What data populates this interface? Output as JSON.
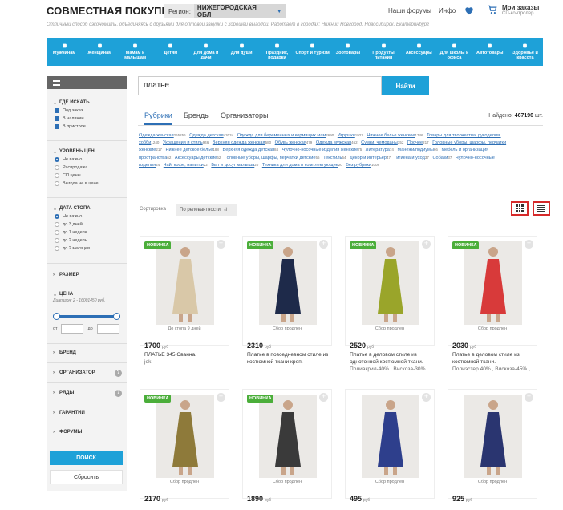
{
  "header": {
    "logo": "СОВМЕСТНАЯ ПОКУПКА",
    "slogan": "Отличный способ сэкономить, объединяясь с друзьями для оптовой закупки с хорошей выгодой. Работает в городах: Нижний Новгород, Новосибирск, Екатеринбург",
    "region_label": "Регион:",
    "region_value": "НИЖЕГОРОДСКАЯ ОБЛ",
    "links": [
      "Наши форумы",
      "Инфо"
    ],
    "orders_title": "Мои заказы",
    "orders_sub": "СП-контролер"
  },
  "categories": [
    {
      "label": "Мужчинам",
      "icon": "shirt-icon"
    },
    {
      "label": "Женщинам",
      "icon": "dress-icon"
    },
    {
      "label": "Мамам и малышам",
      "icon": "stroller-icon"
    },
    {
      "label": "Детям",
      "icon": "child-icon"
    },
    {
      "label": "Для дома и дачи",
      "icon": "house-icon"
    },
    {
      "label": "Для души",
      "icon": "book-icon"
    },
    {
      "label": "Праздник, подарки",
      "icon": "gift-icon"
    },
    {
      "label": "Спорт и туризм",
      "icon": "bicycle-icon"
    },
    {
      "label": "Зоотовары",
      "icon": "paw-icon"
    },
    {
      "label": "Продукты питания",
      "icon": "food-icon"
    },
    {
      "label": "Аксессуары",
      "icon": "glasses-icon"
    },
    {
      "label": "Для школы и офиса",
      "icon": "briefcase-icon"
    },
    {
      "label": "Автотовары",
      "icon": "car-icon"
    },
    {
      "label": "Здоровье и красота",
      "icon": "beauty-icon"
    }
  ],
  "sidebar": {
    "where": {
      "title": "ГДЕ ИСКАТЬ",
      "options": [
        "Под заказ",
        "В наличии",
        "В пристрое"
      ]
    },
    "price_level": {
      "title": "УРОВЕНЬ ЦЕН",
      "options": [
        "Не важно",
        "Распродажа",
        "СП цены",
        "Выгода не в цене"
      ]
    },
    "stop_date": {
      "title": "ДАТА СТОПА",
      "options": [
        "Не важно",
        "до 3 дней",
        "до 1 недели",
        "до 2 недель",
        "до 2 месяцев"
      ]
    },
    "size": {
      "title": "РАЗМЕР"
    },
    "price": {
      "title": "ЦЕНА",
      "range_label": "Диапазон: 2 - 16001450 руб.",
      "from_label": "от",
      "to_label": "до",
      "low_fraction": 0.0,
      "high_fraction": 1.0
    },
    "brand": {
      "title": "БРЕНД"
    },
    "organizer": {
      "title": "ОРГАНИЗАТОР"
    },
    "rows": {
      "title": "РЯДЫ"
    },
    "guarantees": {
      "title": "ГАРАНТИИ"
    },
    "forums": {
      "title": "ФОРУМЫ"
    },
    "search_button": "ПОИСК",
    "reset_button": "Сбросить"
  },
  "search": {
    "value": "платье",
    "button": "Найти"
  },
  "tabs": [
    {
      "label": "Рубрики"
    },
    {
      "label": "Бренды"
    },
    {
      "label": "Организаторы"
    }
  ],
  "found": {
    "label": "Найдено:",
    "count": "467196",
    "unit": "шт."
  },
  "rubrics": [
    {
      "name": "Одежда женская",
      "count": "265256"
    },
    {
      "name": "Одежда детская",
      "count": "43034"
    },
    {
      "name": "Одежда для беременных и кормящих мам",
      "count": "2690"
    },
    {
      "name": "Игрушки",
      "count": "1927"
    },
    {
      "name": "Нижнее белье женское",
      "count": "1746"
    },
    {
      "name": "Товары для творчества, рукоделия, хобби",
      "count": "1240"
    },
    {
      "name": "Украшения и стиль",
      "count": "946"
    },
    {
      "name": "Верхняя одежда женская",
      "count": "580"
    },
    {
      "name": "Обувь женская",
      "count": "479"
    },
    {
      "name": "Одежда мужская",
      "count": "462"
    },
    {
      "name": "Сумки, чемоданы",
      "count": "352"
    },
    {
      "name": "Прочее",
      "count": "217"
    },
    {
      "name": "Головные уборы, шарфы, перчатки женские",
      "count": "217"
    },
    {
      "name": "Нижнее детское белье",
      "count": "188"
    },
    {
      "name": "Верхняя одежда детская",
      "count": "84"
    },
    {
      "name": "Чулочно-носочные изделия женские",
      "count": "75"
    },
    {
      "name": "Литература",
      "count": "74"
    },
    {
      "name": "Манежи/подиумы",
      "count": "66"
    },
    {
      "name": "Мебель и организация пространства",
      "count": "62"
    },
    {
      "name": "Аксессуары детские",
      "count": "62"
    },
    {
      "name": "Головные уборы, шарфы, перчатки детские",
      "count": "56"
    },
    {
      "name": "Текстиль",
      "count": "54"
    },
    {
      "name": "Декор и интерьер",
      "count": "47"
    },
    {
      "name": "Гигиена и уход",
      "count": "37"
    },
    {
      "name": "Собаки",
      "count": "37"
    },
    {
      "name": "Чулочно-носочные изделия",
      "count": "24"
    },
    {
      "name": "Чай, кофе, напитки",
      "count": "22"
    },
    {
      "name": "Быт и досуг малыша",
      "count": "20"
    },
    {
      "name": "Техника для дома и комплектующие",
      "count": "20"
    },
    {
      "name": "Без рубрики",
      "count": "1008"
    }
  ],
  "sort": {
    "label": "Сортировка",
    "value": "По релевантности"
  },
  "products": [
    {
      "badge": "НОВИНКА",
      "status": "До стопа 9 дней",
      "price": "1700",
      "currency": "руб",
      "title": "ПЛАТЬЕ 345 Сванна.",
      "meta": "jok",
      "dress_color": "#d9c8a8"
    },
    {
      "badge": "НОВИНКА",
      "status": "Сбор продлен",
      "price": "2310",
      "currency": "руб",
      "title": "Платье в повседневном стиле из костюмной ткани креп.",
      "meta": "",
      "dress_color": "#1e2a4a"
    },
    {
      "badge": "НОВИНКА",
      "status": "Сбор продлен",
      "price": "2520",
      "currency": "руб",
      "title": "Платье в деловом стиле из однотонной костюмной ткани.",
      "meta": "Полиакрил-40% , Вискоза-30% ...",
      "dress_color": "#9aa52a"
    },
    {
      "badge": "НОВИНКА",
      "status": "Сбор продлен",
      "price": "2030",
      "currency": "руб",
      "title": "Платье в деловом стиле из костюмной ткани.",
      "meta": "Полиэстер 40% , Вискоза-45% ,...",
      "dress_color": "#d83a3a"
    },
    {
      "badge": "НОВИНКА",
      "status": "Сбор продлен",
      "price": "2170",
      "currency": "руб",
      "title": "",
      "meta": "",
      "dress_color": "#8e7a3a"
    },
    {
      "badge": "НОВИНКА",
      "status": "Сбор продлен",
      "price": "1890",
      "currency": "руб",
      "title": "",
      "meta": "",
      "dress_color": "#3a3a3a"
    },
    {
      "badge": "",
      "status": "Сбор продлен",
      "price": "495",
      "currency": "руб",
      "title": "",
      "meta": "",
      "dress_color": "#2e3f8c"
    },
    {
      "badge": "",
      "status": "Сбор продлен",
      "price": "925",
      "currency": "руб",
      "title": "",
      "meta": "",
      "dress_color": "#2a3570"
    }
  ]
}
